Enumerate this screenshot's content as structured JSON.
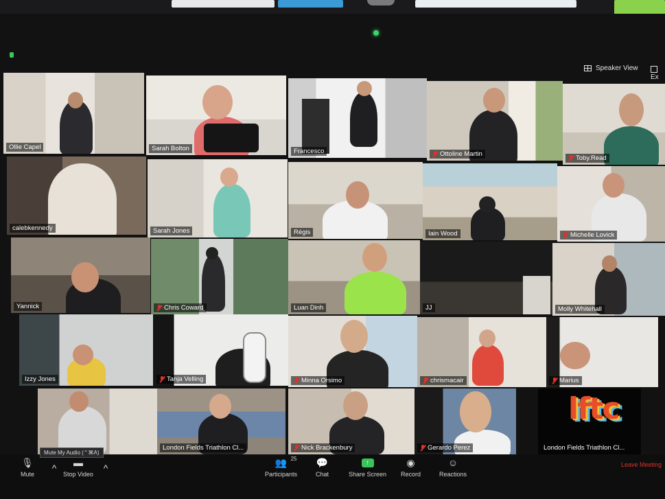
{
  "header": {
    "speaker_view_label": "Speaker View",
    "exit_label": "Ex"
  },
  "participants": [
    {
      "name": "Ollie Capel",
      "muted": false
    },
    {
      "name": "Sarah Bolton",
      "muted": false
    },
    {
      "name": "Francesco",
      "muted": false
    },
    {
      "name": "Ottoline Martin",
      "muted": true
    },
    {
      "name": "Toby.Read",
      "muted": true
    },
    {
      "name": "calebkennedy",
      "muted": false
    },
    {
      "name": "Sarah Jones",
      "muted": false,
      "active_speaker": true
    },
    {
      "name": "Régis",
      "muted": false
    },
    {
      "name": "Iain Wood",
      "muted": false
    },
    {
      "name": "Michelle Lovick",
      "muted": true
    },
    {
      "name": "Yannick",
      "muted": false
    },
    {
      "name": "Chris Coward",
      "muted": true
    },
    {
      "name": "Luan Dinh",
      "muted": false
    },
    {
      "name": "JJ",
      "muted": false
    },
    {
      "name": "Molly Whitehall",
      "muted": false
    },
    {
      "name": "Izzy Jones",
      "muted": false
    },
    {
      "name": "Tanja Velling",
      "muted": true
    },
    {
      "name": "Minna Orsimo",
      "muted": true
    },
    {
      "name": "chrismacair",
      "muted": true
    },
    {
      "name": "Marius",
      "muted": true
    },
    {
      "name": "",
      "muted": false
    },
    {
      "name": "London Fields Triathlon Cl...",
      "muted": false
    },
    {
      "name": "Nick Brackenbury",
      "muted": true
    },
    {
      "name": "Gerardo Perez",
      "muted": true
    },
    {
      "name": "London Fields Triathlon Cl...",
      "muted": false
    }
  ],
  "logo_text": "lftc",
  "toolbar": {
    "mute_label": "Mute",
    "tooltip": "Mute My Audio (⌃⌘A)",
    "stop_video_label": "Stop Video",
    "participants_label": "Participants",
    "participants_count": "25",
    "chat_label": "Chat",
    "share_label": "Share Screen",
    "record_label": "Record",
    "reactions_label": "Reactions",
    "leave_label": "Leave Meeting"
  },
  "colors": {
    "active_speaker_border": "#e3e25a",
    "share_screen_green": "#3ac25b",
    "muted_red": "#e0312b",
    "leave_red": "#e0312b"
  }
}
